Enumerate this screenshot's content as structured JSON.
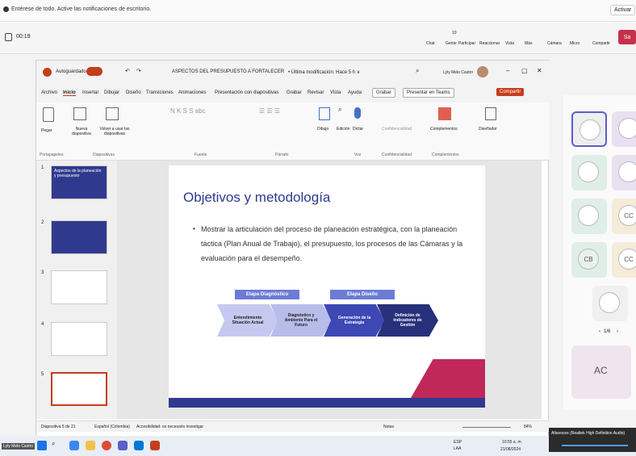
{
  "notification": {
    "text": "Entérese de todo. Active las notificaciones de escritorio.",
    "action": "Activar"
  },
  "meeting": {
    "timer": "00:19",
    "tools": [
      "Chat",
      "Gente",
      "Participar",
      "Reaccionar",
      "Vista",
      "Más",
      "Cámara",
      "Micro",
      "Compartir"
    ],
    "people_count": "10",
    "leave_label": "Sa"
  },
  "ppt": {
    "autosave": "Autoguardado",
    "title": "ASPECTOS DEL PRESUPUESTO A FORTALECER",
    "modified": "• Última modificación: Hace 5 h ∨",
    "user": "Lyly Melo Castro",
    "menu": [
      "Archivo",
      "Inicio",
      "Insertar",
      "Dibujar",
      "Diseño",
      "Transiciones",
      "Animaciones",
      "Presentación con diapositivas",
      "Grabar",
      "Revisar",
      "Vista",
      "Ayuda"
    ],
    "grabar": "Grabar",
    "present_teams": "Presentar en Teams",
    "compartir": "Compartir",
    "ribbon": {
      "pegar": "Pegar",
      "nueva": "Nueva diapositiva",
      "volver": "Volver a usar las diapositivas",
      "dibujo": "Dibujo",
      "edicion": "Edición",
      "dictar": "Dictar",
      "conf": "Confidencialidad",
      "compl": "Complementos",
      "disen": "Diseñador",
      "groups": [
        "Portapapeles",
        "Diapositivas",
        "Fuente",
        "Párrafo",
        "Voz",
        "Confidencialidad",
        "Complementos"
      ]
    },
    "slide": {
      "title": "Objetivos y metodología",
      "bullet": "Mostrar la articulación del proceso de planeación estratégica, con la planeación táctica (Plan Anual de Trabajo), el presupuesto, los procesos de las Cámaras y la evaluación para el desempeño.",
      "stage1": "Etapa Diagnóstico",
      "stage2": "Etapa Diseño",
      "steps": [
        "Entendimiento Situación Actual",
        "Diagnóstico y Ambiente Para el Futuro",
        "Generación de la Estrategia",
        "Definición de Indicadores de Gestión"
      ]
    },
    "thumbs": [
      "1",
      "2",
      "3",
      "4",
      "5"
    ],
    "thumb1_text": "Aspectos de la planeación y presupuesto",
    "status": {
      "slide": "Diapositiva 5 de 21",
      "lang": "Español (Colombia)",
      "access": "Accesibilidad: es necesario investigar",
      "notes": "Notas",
      "zoom": "84%"
    }
  },
  "panel": {
    "avatars": [
      "CC",
      "CB",
      "CC",
      "AC"
    ],
    "pager": "1/6"
  },
  "taskbar": {
    "user": "Lyly Melo Castro",
    "audio": "Altavoces (Realtek High Definition Audio)",
    "lang1": "ESP",
    "lang2": "LAA",
    "time": "10:55 a. m.",
    "date": "21/08/2024"
  }
}
